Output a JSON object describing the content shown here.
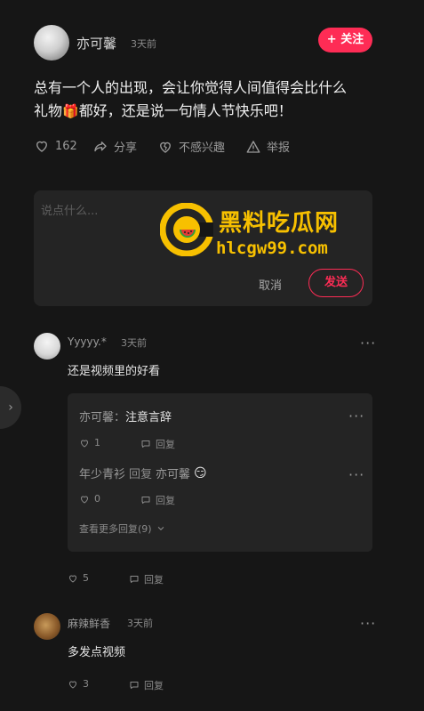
{
  "post": {
    "author": "亦可馨",
    "time": "3天前",
    "follow_label": "+ 关注",
    "text_line1": "总有一个人的出现，会让你觉得人间值得会比什么",
    "text_line2": "礼物",
    "text_line2_rest": "都好，还是说一句情人节快乐吧！",
    "gift_emoji": "🎁",
    "likes": "162",
    "share_label": "分享",
    "not_interested_label": "不感兴趣",
    "report_label": "举报"
  },
  "composer": {
    "placeholder": "说点什么...",
    "cancel_label": "取消",
    "send_label": "发送"
  },
  "watermark": {
    "title": "黑料吃瓜网",
    "url": "hlcgw99.com"
  },
  "comments": [
    {
      "author": "Yyyyy.*",
      "time": "3天前",
      "text": "还是视频里的好看",
      "likes": "5",
      "reply_label": "回复",
      "replies": [
        {
          "author": "亦可馨：",
          "text": "注意言辞",
          "likes": "1",
          "reply_label": "回复"
        },
        {
          "author": "年少青衫",
          "mid": "回复",
          "target": "亦可馨",
          "emoji": "😏",
          "likes": "0",
          "reply_label": "回复"
        }
      ],
      "more_replies": "查看更多回复(9)"
    },
    {
      "author": "麻辣鲜香",
      "time": "3天前",
      "text": "多发点视频",
      "likes": "3",
      "reply_label": "回复"
    }
  ],
  "colors": {
    "accent": "#fe2c55",
    "background": "#161616",
    "watermark": "#f7c000"
  }
}
